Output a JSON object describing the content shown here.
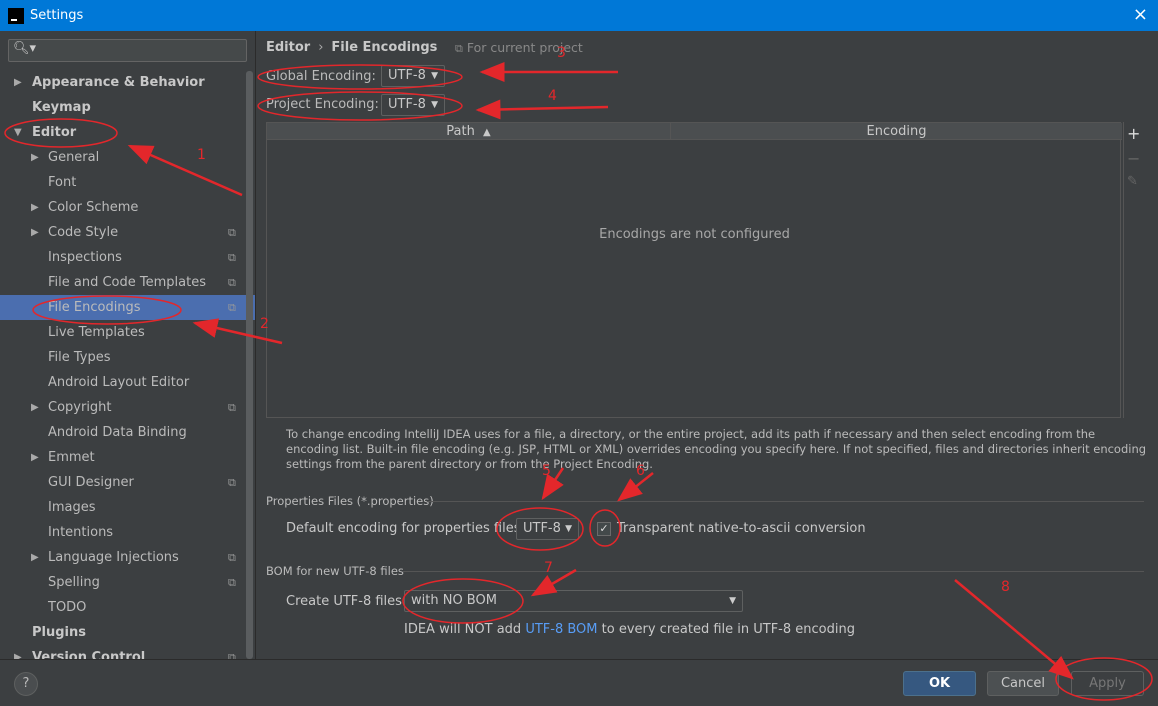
{
  "window": {
    "title": "Settings",
    "close_icon": "×"
  },
  "sidebar": {
    "search_placeholder": "",
    "items": [
      {
        "label": "Appearance & Behavior",
        "level": 0,
        "bold": true,
        "expandable": true,
        "expanded": false,
        "copy": false
      },
      {
        "label": "Keymap",
        "level": 0,
        "bold": true,
        "expandable": false,
        "copy": false
      },
      {
        "label": "Editor",
        "level": 0,
        "bold": true,
        "expandable": true,
        "expanded": true,
        "copy": false
      },
      {
        "label": "General",
        "level": 1,
        "expandable": true,
        "expanded": false,
        "copy": false
      },
      {
        "label": "Font",
        "level": 1,
        "expandable": false,
        "copy": false
      },
      {
        "label": "Color Scheme",
        "level": 1,
        "expandable": true,
        "expanded": false,
        "copy": false
      },
      {
        "label": "Code Style",
        "level": 1,
        "expandable": true,
        "expanded": false,
        "copy": true
      },
      {
        "label": "Inspections",
        "level": 1,
        "expandable": false,
        "copy": true
      },
      {
        "label": "File and Code Templates",
        "level": 1,
        "expandable": false,
        "copy": true
      },
      {
        "label": "File Encodings",
        "level": 1,
        "expandable": false,
        "copy": true,
        "selected": true
      },
      {
        "label": "Live Templates",
        "level": 1,
        "expandable": false,
        "copy": false
      },
      {
        "label": "File Types",
        "level": 1,
        "expandable": false,
        "copy": false
      },
      {
        "label": "Android Layout Editor",
        "level": 1,
        "expandable": false,
        "copy": false
      },
      {
        "label": "Copyright",
        "level": 1,
        "expandable": true,
        "expanded": false,
        "copy": true
      },
      {
        "label": "Android Data Binding",
        "level": 1,
        "expandable": false,
        "copy": false
      },
      {
        "label": "Emmet",
        "level": 1,
        "expandable": true,
        "expanded": false,
        "copy": false
      },
      {
        "label": "GUI Designer",
        "level": 1,
        "expandable": false,
        "copy": true
      },
      {
        "label": "Images",
        "level": 1,
        "expandable": false,
        "copy": false
      },
      {
        "label": "Intentions",
        "level": 1,
        "expandable": false,
        "copy": false
      },
      {
        "label": "Language Injections",
        "level": 1,
        "expandable": true,
        "expanded": false,
        "copy": true
      },
      {
        "label": "Spelling",
        "level": 1,
        "expandable": false,
        "copy": true
      },
      {
        "label": "TODO",
        "level": 1,
        "expandable": false,
        "copy": false
      },
      {
        "label": "Plugins",
        "level": 0,
        "bold": true,
        "expandable": false,
        "copy": false
      },
      {
        "label": "Version Control",
        "level": 0,
        "bold": true,
        "expandable": true,
        "expanded": false,
        "copy": true
      }
    ]
  },
  "main": {
    "breadcrumb": {
      "parent": "Editor",
      "separator": "›",
      "current": "File Encodings"
    },
    "scope_note": "For current project",
    "global_encoding": {
      "label": "Global Encoding:",
      "value": "UTF-8"
    },
    "project_encoding": {
      "label": "Project Encoding:",
      "value": "UTF-8"
    },
    "table": {
      "columns": [
        "Path",
        "Encoding"
      ],
      "sort_indicator": "▲",
      "empty_message": "Encodings are not configured",
      "tools": [
        "+",
        "−",
        "✎"
      ]
    },
    "help_text": "To change encoding IntelliJ IDEA uses for a file, a directory, or the entire project, add its path if necessary and then select encoding from the encoding list. Built-in file encoding (e.g. JSP, HTML or XML) overrides encoding you specify here. If not specified, files and directories inherit encoding settings from the parent directory or from the Project Encoding.",
    "properties": {
      "section_title": "Properties Files (*.properties)",
      "default_label": "Default encoding for properties files:",
      "default_value": "UTF-8",
      "native_checkbox_label": "Transparent native-to-ascii conversion",
      "native_checked": true
    },
    "bom": {
      "section_title": "BOM for new UTF-8 files",
      "create_label": "Create UTF-8 files:",
      "create_value": "with NO BOM",
      "note_prefix": "IDEA will NOT add ",
      "note_link": "UTF-8 BOM",
      "note_suffix": " to every created file in UTF-8 encoding"
    }
  },
  "footer": {
    "help": "?",
    "ok": "OK",
    "cancel": "Cancel",
    "apply": "Apply"
  },
  "annotations": {
    "color": "#e3272b",
    "numbers": [
      "1",
      "2",
      "3",
      "4",
      "5",
      "6",
      "7",
      "8"
    ]
  }
}
